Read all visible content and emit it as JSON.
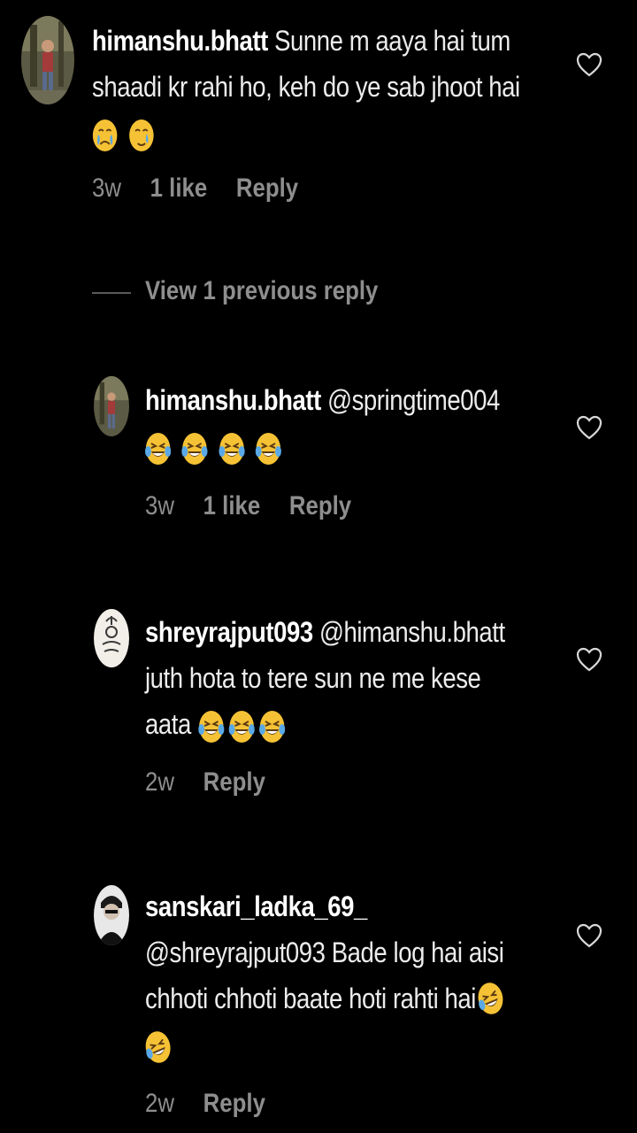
{
  "comments": [
    {
      "username": "himanshu.bhatt",
      "line1": " Sunne m aaya hai tum",
      "line2": "shaadi kr rahi ho, keh do ye sab jhoot hai",
      "line3": "",
      "emoji": "crying-face",
      "time": "3w",
      "likes": "1 like",
      "reply": "Reply"
    },
    {
      "username": "himanshu.bhatt",
      "line1": " @springtime004",
      "line2": "",
      "line3": "",
      "emoji": "tears-of-joy-face",
      "time": "3w",
      "likes": "1 like",
      "reply": "Reply"
    },
    {
      "username": "shreyrajput093",
      "line1": " @himanshu.bhatt",
      "line2": "juth hota to tere sun ne me kese",
      "line3": "aata",
      "emoji": "tears-of-joy-face",
      "time": "2w",
      "likes": "",
      "reply": "Reply"
    },
    {
      "username": "sanskari_ladka_69_",
      "line1": "",
      "line2": "@shreyrajput093 Bade  log hai aisi",
      "line3": "chhoti chhoti baate hoti rahti hai",
      "emoji": "rolling-laughing-face",
      "time": "2w",
      "likes": "",
      "reply": "Reply"
    }
  ],
  "view_replies": "View 1 previous reply",
  "colors": {
    "background": "#000000",
    "text": "#ececec",
    "muted": "#8e8e8e",
    "emoji_yellow": "#f6c235"
  }
}
